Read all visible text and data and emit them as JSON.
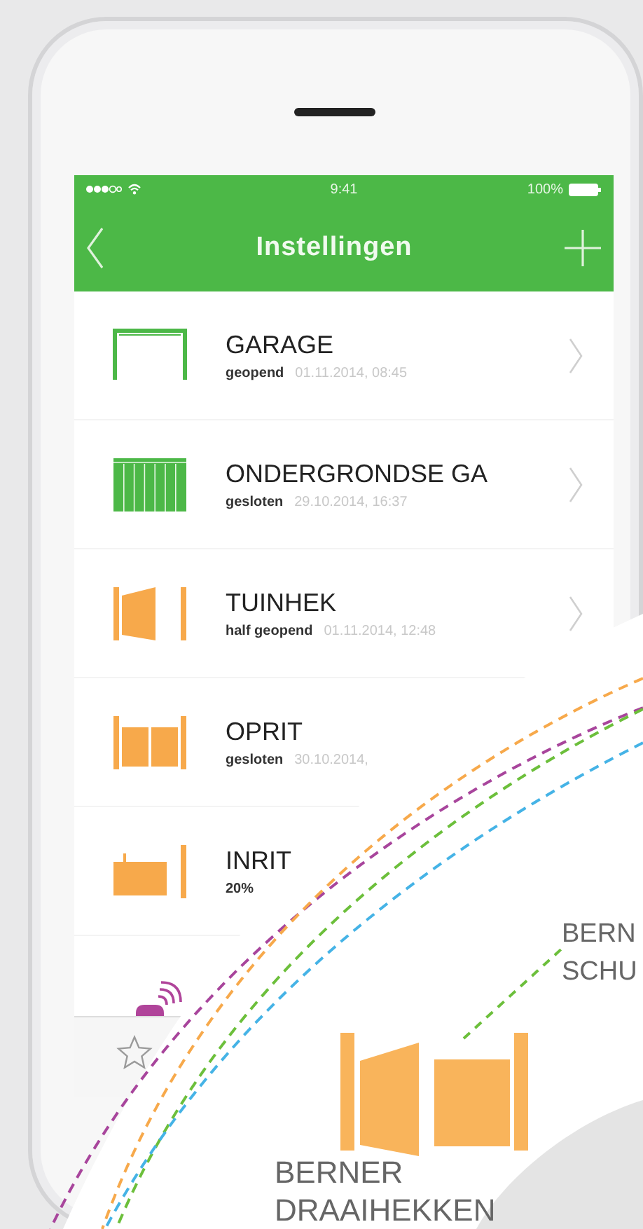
{
  "status_bar": {
    "time": "9:41",
    "battery": "100%"
  },
  "nav_bar": {
    "title": "Instellingen"
  },
  "devices": [
    {
      "kind": "garage_open",
      "color": "#4cb847",
      "name": "GARAGE",
      "state": "geopend",
      "time": "01.11.2014, 08:45"
    },
    {
      "kind": "garage_closed",
      "color": "#4cb847",
      "name": "ONDERGRONDSE GA",
      "state": "gesloten",
      "time": "29.10.2014, 16:37"
    },
    {
      "kind": "swing_half",
      "color": "#f7a94b",
      "name": "TUINHEK",
      "state": "half geopend",
      "time": "01.11.2014, 12:48"
    },
    {
      "kind": "double_closed",
      "color": "#f7a94b",
      "name": "OPRIT",
      "state": "gesloten",
      "time": "30.10.2014,"
    },
    {
      "kind": "sliding",
      "color": "#f7a94b",
      "name": "INRIT",
      "state": "20%"
    },
    {
      "kind": "remote",
      "color": "#b0449a"
    }
  ],
  "callouts": [
    {
      "kind": "right",
      "lines": [
        "BERN",
        "SCHU"
      ]
    },
    {
      "kind": "gate",
      "lines": [
        "BERNER",
        "DRAAIHEKKEN"
      ]
    }
  ]
}
